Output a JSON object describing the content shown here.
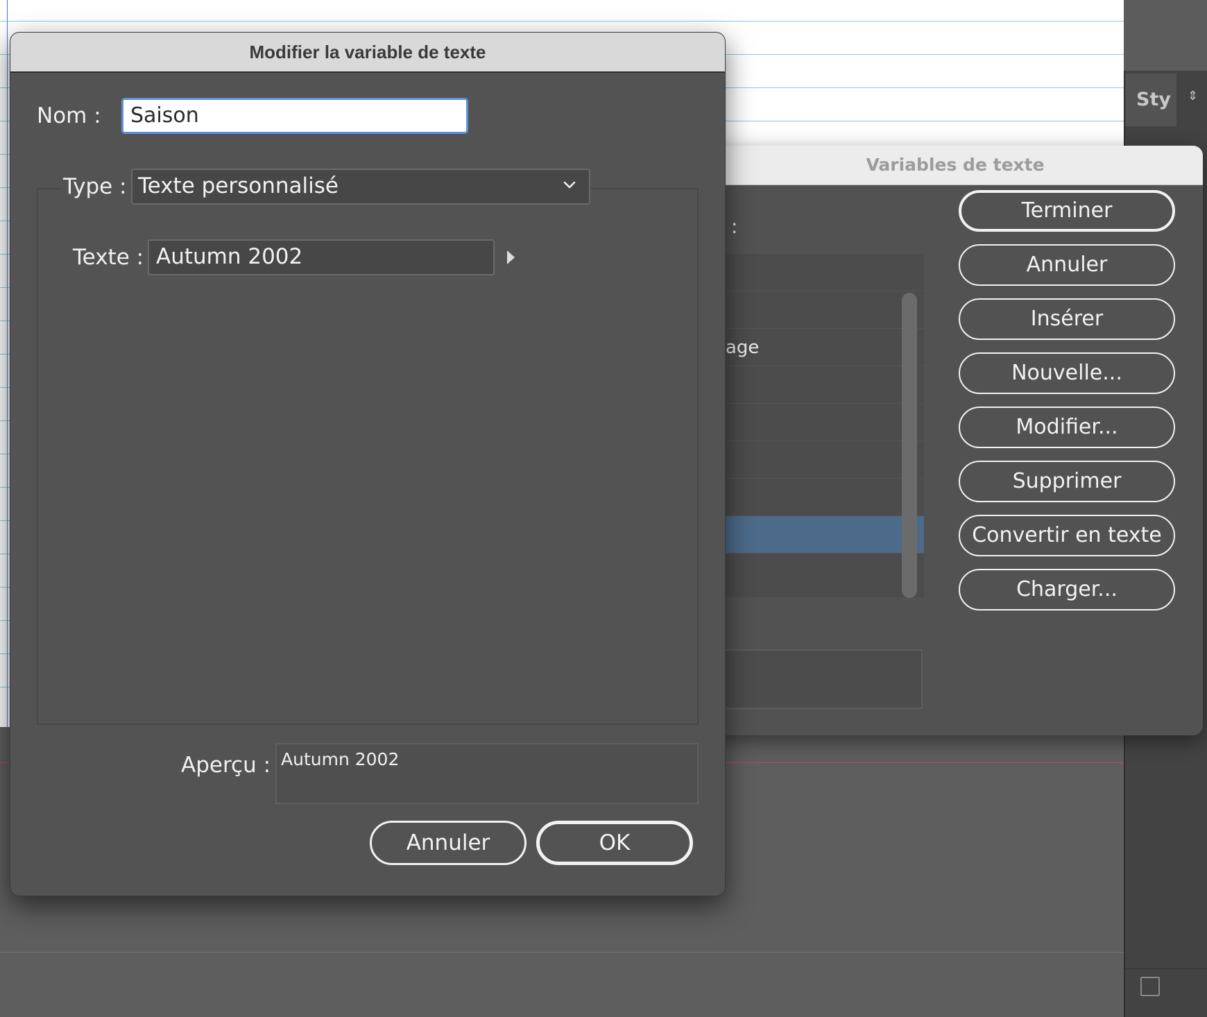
{
  "edit_dialog": {
    "title": "Modifier la variable de texte",
    "name_label": "Nom :",
    "name_value": "Saison",
    "type_label": "Type :",
    "type_value": "Texte personnalisé",
    "text_label": "Texte :",
    "text_value": "Autumn 2002",
    "preview_label": "Aperçu :",
    "preview_value": "Autumn 2002",
    "cancel_label": "Annuler",
    "ok_label": "OK"
  },
  "variables_dialog": {
    "title": "Variables de texte",
    "list_label": ":",
    "list_items": [
      "",
      "",
      "age",
      "",
      "",
      "",
      "",
      ""
    ],
    "selected_index": 7,
    "buttons": {
      "done": "Terminer",
      "cancel": "Annuler",
      "insert": "Insérer",
      "new": "Nouvelle...",
      "edit": "Modifier...",
      "delete": "Supprimer",
      "convert": "Convertir en texte",
      "load": "Charger..."
    }
  },
  "right_panel": {
    "tab_label": "Sty"
  }
}
